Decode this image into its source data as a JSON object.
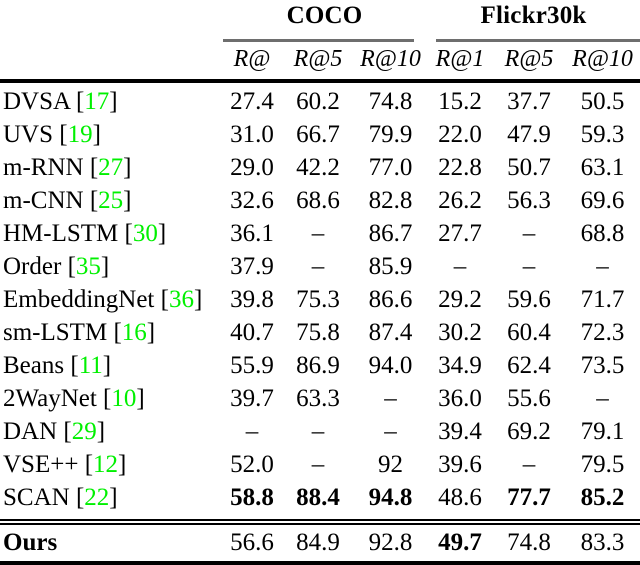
{
  "table": {
    "caption": "",
    "groups": [
      {
        "label": "COCO",
        "span": 3
      },
      {
        "label": "Flickr30k",
        "span": 3
      }
    ],
    "columns": [
      {
        "key": "method",
        "label": ""
      },
      {
        "key": "coco_r1",
        "label": "R@"
      },
      {
        "key": "coco_r5",
        "label": "R@5"
      },
      {
        "key": "coco_r10",
        "label": "R@10"
      },
      {
        "key": "fl_r1",
        "label": "R@1"
      },
      {
        "key": "fl_r5",
        "label": "R@5"
      },
      {
        "key": "fl_r10",
        "label": "R@10"
      }
    ],
    "citation_color": "#00f000",
    "rows": [
      {
        "method": "DVSA",
        "cite": "[17]",
        "values": [
          "27.4",
          "60.2",
          "74.8",
          "15.2",
          "37.7",
          "50.5"
        ],
        "bold": [
          false,
          false,
          false,
          false,
          false,
          false
        ]
      },
      {
        "method": "UVS",
        "cite": "[19]",
        "values": [
          "31.0",
          "66.7",
          "79.9",
          "22.0",
          "47.9",
          "59.3"
        ],
        "bold": [
          false,
          false,
          false,
          false,
          false,
          false
        ]
      },
      {
        "method": "m-RNN",
        "cite": "[27]",
        "values": [
          "29.0",
          "42.2",
          "77.0",
          "22.8",
          "50.7",
          "63.1"
        ],
        "bold": [
          false,
          false,
          false,
          false,
          false,
          false
        ]
      },
      {
        "method": "m-CNN",
        "cite": "[25]",
        "values": [
          "32.6",
          "68.6",
          "82.8",
          "26.2",
          "56.3",
          "69.6"
        ],
        "bold": [
          false,
          false,
          false,
          false,
          false,
          false
        ]
      },
      {
        "method": "HM-LSTM",
        "cite": "[30]",
        "values": [
          "36.1",
          "–",
          "86.7",
          "27.7",
          "–",
          "68.8"
        ],
        "bold": [
          false,
          false,
          false,
          false,
          false,
          false
        ]
      },
      {
        "method": "Order",
        "cite": "[35]",
        "values": [
          "37.9",
          "–",
          "85.9",
          "–",
          "–",
          "–"
        ],
        "bold": [
          false,
          false,
          false,
          false,
          false,
          false
        ]
      },
      {
        "method": "EmbeddingNet",
        "cite": "[36]",
        "values": [
          "39.8",
          "75.3",
          "86.6",
          "29.2",
          "59.6",
          "71.7"
        ],
        "bold": [
          false,
          false,
          false,
          false,
          false,
          false
        ]
      },
      {
        "method": "sm-LSTM",
        "cite": "[16]",
        "values": [
          "40.7",
          "75.8",
          "87.4",
          "30.2",
          "60.4",
          "72.3"
        ],
        "bold": [
          false,
          false,
          false,
          false,
          false,
          false
        ]
      },
      {
        "method": "Beans",
        "cite": "[11]",
        "values": [
          "55.9",
          "86.9",
          "94.0",
          "34.9",
          "62.4",
          "73.5"
        ],
        "bold": [
          false,
          false,
          false,
          false,
          false,
          false
        ]
      },
      {
        "method": "2WayNet",
        "cite": "[10]",
        "values": [
          "39.7",
          "63.3",
          "–",
          "36.0",
          "55.6",
          "–"
        ],
        "bold": [
          false,
          false,
          false,
          false,
          false,
          false
        ]
      },
      {
        "method": "DAN",
        "cite": "[29]",
        "values": [
          "–",
          "–",
          "–",
          "39.4",
          "69.2",
          "79.1"
        ],
        "bold": [
          false,
          false,
          false,
          false,
          false,
          false
        ]
      },
      {
        "method": "VSE++",
        "cite": "[12]",
        "values": [
          "52.0",
          "–",
          "92",
          "39.6",
          "–",
          "79.5"
        ],
        "bold": [
          false,
          false,
          false,
          false,
          false,
          false
        ]
      },
      {
        "method": "SCAN",
        "cite": "[22]",
        "values": [
          "58.8",
          "88.4",
          "94.8",
          "48.6",
          "77.7",
          "85.2"
        ],
        "bold": [
          true,
          true,
          true,
          false,
          true,
          true
        ]
      }
    ],
    "ours": {
      "method": "Ours",
      "cite": "",
      "values": [
        "56.6",
        "84.9",
        "92.8",
        "49.7",
        "74.8",
        "83.3"
      ],
      "bold": [
        false,
        false,
        false,
        true,
        false,
        false
      ]
    }
  }
}
